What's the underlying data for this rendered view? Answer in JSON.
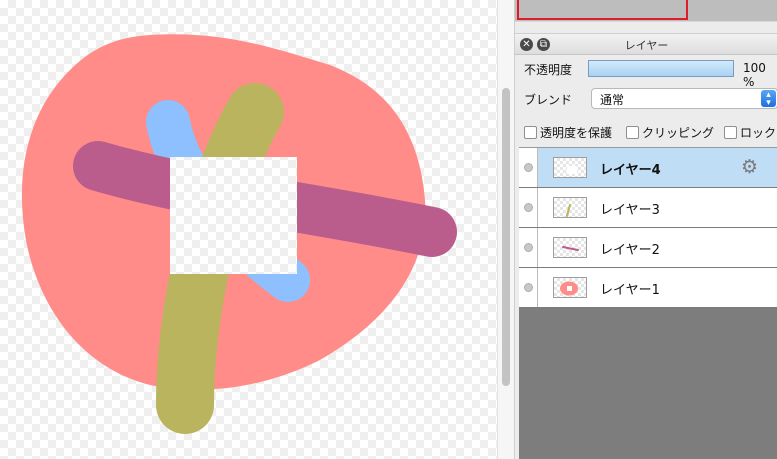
{
  "panel": {
    "title": "レイヤー",
    "close_icon": "close-icon",
    "restore_icon": "restore-icon"
  },
  "opacity": {
    "label": "不透明度",
    "value_text": "100 %",
    "value_fraction": 1.0
  },
  "blend": {
    "label": "ブレンド",
    "selected": "通常"
  },
  "options": {
    "protect_transparency": "透明度を保護",
    "clipping": "クリッピング",
    "lock": "ロック"
  },
  "layers": [
    {
      "name": "レイヤー4",
      "selected": true
    },
    {
      "name": "レイヤー3",
      "selected": false
    },
    {
      "name": "レイヤー2",
      "selected": false
    },
    {
      "name": "レイヤー1",
      "selected": false
    }
  ],
  "colors": {
    "salmon": "#ff8c88",
    "blue": "#8ec0ff",
    "olive": "#bab45e",
    "mauve": "#bb5d8c",
    "selection": "#c0ddf6",
    "nav_frame": "#e0192b"
  }
}
